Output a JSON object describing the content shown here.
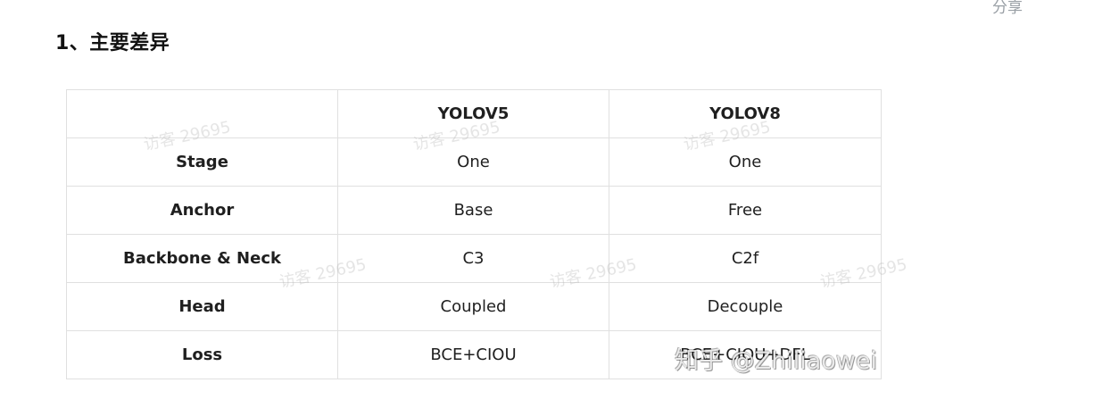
{
  "header": {
    "share_label": "分享"
  },
  "section": {
    "heading": "1、主要差异"
  },
  "table": {
    "columns": [
      "",
      "YOLOV5",
      "YOLOV8"
    ],
    "rows": [
      {
        "label": "Stage",
        "yolov5": "One",
        "yolov8": "One"
      },
      {
        "label": "Anchor",
        "yolov5": "Base",
        "yolov8": "Free"
      },
      {
        "label": "Backbone & Neck",
        "yolov5": "C3",
        "yolov8": "C2f"
      },
      {
        "label": "Head",
        "yolov5": "Coupled",
        "yolov8": "Decouple"
      },
      {
        "label": "Loss",
        "yolov5": "BCE+CIOU",
        "yolov8": "BCE+CIOU+DFL"
      }
    ]
  },
  "watermarks": {
    "visit_text": "访客 29695",
    "brand_text": "知乎 @Zhiliaowei"
  }
}
